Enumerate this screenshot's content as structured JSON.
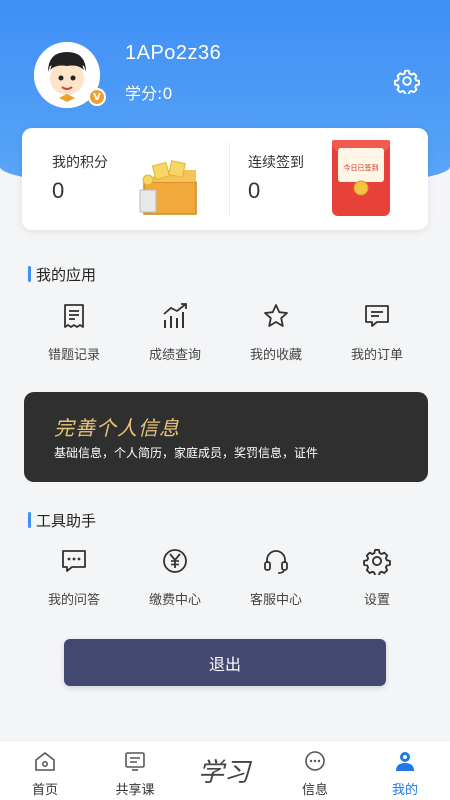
{
  "profile": {
    "username": "1APo2z36",
    "credits_label": "学分:0",
    "badge": "V"
  },
  "stats": {
    "points_label": "我的积分",
    "points_value": "0",
    "checkin_label": "连续签到",
    "checkin_value": "0",
    "envelope_text": "今日已签到"
  },
  "my_apps": {
    "title": "我的应用",
    "items": [
      {
        "label": "错题记录",
        "icon": "receipt-icon"
      },
      {
        "label": "成绩查询",
        "icon": "chart-icon"
      },
      {
        "label": "我的收藏",
        "icon": "star-icon"
      },
      {
        "label": "我的订单",
        "icon": "order-icon"
      }
    ]
  },
  "banner": {
    "title": "完善个人信息",
    "subtitle": "基础信息，个人简历，家庭成员，奖罚信息，证件"
  },
  "tools": {
    "title": "工具助手",
    "items": [
      {
        "label": "我的问答",
        "icon": "chat-icon"
      },
      {
        "label": "缴费中心",
        "icon": "yuan-icon"
      },
      {
        "label": "客服中心",
        "icon": "headset-icon"
      },
      {
        "label": "设置",
        "icon": "gear-icon"
      }
    ]
  },
  "logout_label": "退出",
  "tabbar": {
    "center_logo": "学习",
    "tabs": [
      {
        "label": "首页",
        "icon": "home-icon"
      },
      {
        "label": "共享课",
        "icon": "course-icon"
      },
      {
        "label": "信息",
        "icon": "message-icon"
      },
      {
        "label": "我的",
        "icon": "profile-icon",
        "active": true
      }
    ]
  },
  "colors": {
    "accent": "#1f78e8",
    "header": "#4a9af6",
    "banner_bg": "#2f2f2f",
    "banner_title": "#e8c47a",
    "logout_bg": "#434870"
  }
}
